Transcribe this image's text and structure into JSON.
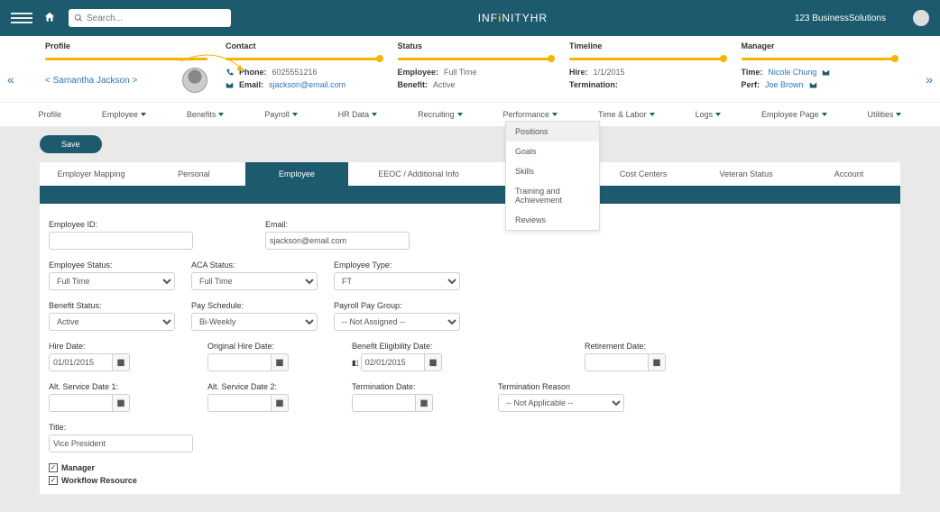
{
  "topbar": {
    "search_placeholder": "Search...",
    "brand_pre": "INF",
    "brand_mid": "i",
    "brand_post": "NITYHR",
    "company": "123 BusinessSolutions"
  },
  "info": {
    "profile": {
      "head": "Profile",
      "name": "< Samantha Jackson >"
    },
    "contact": {
      "head": "Contact",
      "phone_lbl": "Phone:",
      "phone": "6025551216",
      "email_lbl": "Email:",
      "email": "sjackson@email.com"
    },
    "status": {
      "head": "Status",
      "emp_lbl": "Employee:",
      "emp": "Full Time",
      "ben_lbl": "Benefit:",
      "ben": "Active"
    },
    "timeline": {
      "head": "Timeline",
      "hire_lbl": "Hire:",
      "hire": "1/1/2015",
      "term_lbl": "Termination:",
      "term": ""
    },
    "manager": {
      "head": "Manager",
      "time_lbl": "Time:",
      "time": "Nicole Chung",
      "perf_lbl": "Perf:",
      "perf": "Joe Brown"
    }
  },
  "nav": {
    "items": [
      "Profile",
      "Employee",
      "Benefits",
      "Payroll",
      "HR Data",
      "Recruiting",
      "Performance",
      "Time & Labor",
      "Logs",
      "Employee Page",
      "Utilities"
    ]
  },
  "dropdown": {
    "items": [
      "Positions",
      "Goals",
      "Skills",
      "Training and Achievement",
      "Reviews"
    ]
  },
  "action": {
    "save": "Save"
  },
  "tabs": {
    "items": [
      "Employer Mapping",
      "Personal",
      "Employee",
      "EEOC / Additional Info",
      "",
      "Cost Centers",
      "Veteran Status",
      "Account"
    ]
  },
  "form": {
    "employee_id": {
      "label": "Employee ID:",
      "value": ""
    },
    "email": {
      "label": "Email:",
      "value": "sjackson@email.com"
    },
    "emp_status": {
      "label": "Employee Status:",
      "value": "Full Time"
    },
    "aca_status": {
      "label": "ACA Status:",
      "value": "Full Time"
    },
    "emp_type": {
      "label": "Employee Type:",
      "value": "FT"
    },
    "benefit_status": {
      "label": "Benefit Status:",
      "value": "Active"
    },
    "pay_schedule": {
      "label": "Pay Schedule:",
      "value": "Bi-Weekly"
    },
    "pay_group": {
      "label": "Payroll Pay Group:",
      "value": "-- Not Assigned --"
    },
    "hire_date": {
      "label": "Hire Date:",
      "value": "01/01/2015"
    },
    "orig_hire": {
      "label": "Original Hire Date:",
      "value": ""
    },
    "benefit_elig": {
      "label": "Benefit Eligibility Date:",
      "value": "02/01/2015"
    },
    "retirement": {
      "label": "Retirement Date:",
      "value": ""
    },
    "alt_sd1": {
      "label": "Alt. Service Date 1:",
      "value": ""
    },
    "alt_sd2": {
      "label": "Alt. Service Date 2:",
      "value": ""
    },
    "term_date": {
      "label": "Termination Date:",
      "value": ""
    },
    "term_reason": {
      "label": "Termination Reason",
      "value": "-- Not Applicable --"
    },
    "title": {
      "label": "Title:",
      "value": "Vice President"
    },
    "manager_chk": "Manager",
    "workflow_chk": "Workflow Resource"
  }
}
